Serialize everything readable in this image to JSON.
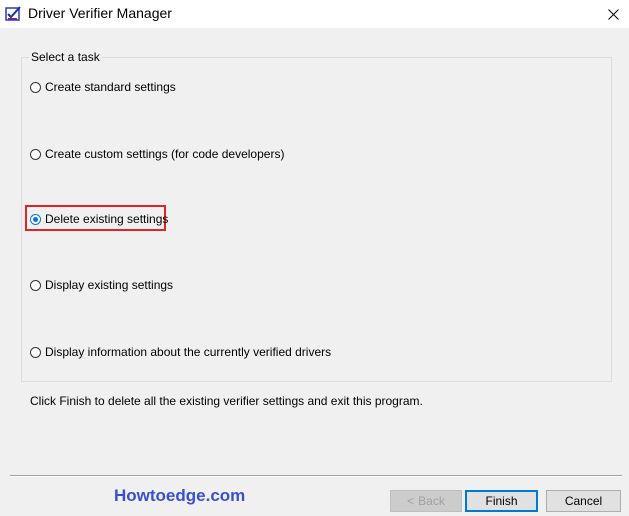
{
  "window": {
    "title": "Driver Verifier Manager",
    "close_glyph": "✕"
  },
  "group": {
    "label": "Select a task"
  },
  "options": [
    {
      "label": "Create standard settings",
      "checked": false
    },
    {
      "label": "Create custom settings (for code developers)",
      "checked": false
    },
    {
      "label": "Delete existing settings",
      "checked": true
    },
    {
      "label": "Display existing settings",
      "checked": false
    },
    {
      "label": "Display information about the currently verified drivers",
      "checked": false
    }
  ],
  "info": {
    "text": "Click Finish to delete all the existing verifier settings and exit this program."
  },
  "watermark": "Howtoedge.com",
  "buttons": {
    "back_arrow": "<",
    "back": "Back",
    "finish": "Finish",
    "cancel": "Cancel"
  },
  "colors": {
    "highlight": "#e0252a",
    "accent": "#0078d7",
    "watermark": "#3a4fd1"
  }
}
